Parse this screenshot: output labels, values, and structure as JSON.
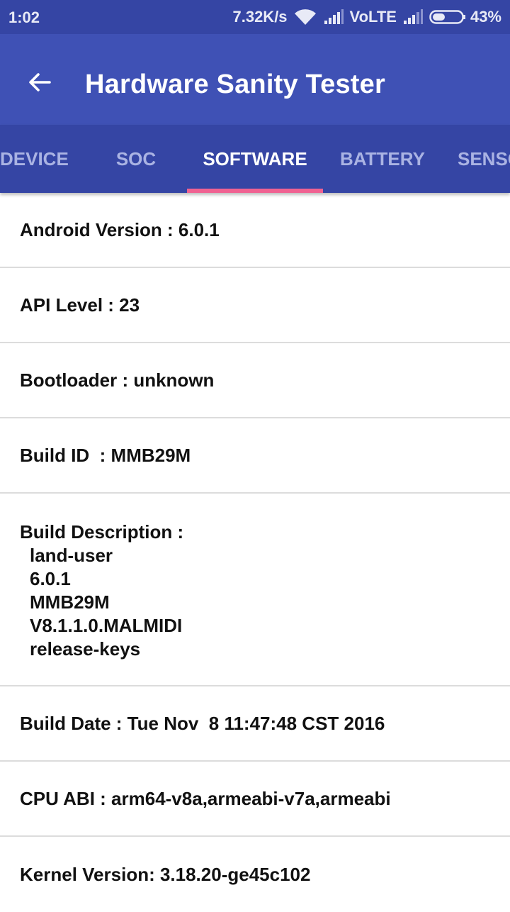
{
  "status_bar": {
    "time": "1:02",
    "net_speed": "7.32K/s",
    "volte": "VoLTE",
    "battery_percent": "43%",
    "battery_level": 0.43,
    "icons": [
      "wifi-icon",
      "signal-icon",
      "signal-icon",
      "battery-icon"
    ]
  },
  "app_bar": {
    "title": "Hardware Sanity Tester",
    "back_icon": "arrow-left-icon"
  },
  "tabs": [
    {
      "label": "DEVICE",
      "active": false
    },
    {
      "label": "SOC",
      "active": false
    },
    {
      "label": "SOFTWARE",
      "active": true
    },
    {
      "label": "BATTERY",
      "active": false
    },
    {
      "label": "SENSORS",
      "active": false
    }
  ],
  "info": {
    "android_version": "Android Version : 6.0.1",
    "api_level": "API Level : 23",
    "bootloader": "Bootloader : unknown",
    "build_id": "Build ID  : MMB29M",
    "build_description_label": "Build Description :",
    "build_description_lines": [
      "land-user",
      "6.0.1",
      "MMB29M",
      "V8.1.1.0.MALMIDI",
      "release-keys"
    ],
    "build_date": "Build Date : Tue Nov  8 11:47:48 CST 2016",
    "cpu_abi": "CPU ABI : arm64-v8a,armeabi-v7a,armeabi",
    "kernel_version": "Kernel Version: 3.18.20-ge45c102"
  },
  "colors": {
    "status_bar": "#3545a4",
    "app_bar": "#3f51b5",
    "tab_bar": "#3545a4",
    "tab_indicator": "#f06292",
    "tab_inactive_text": "#aab3e3"
  }
}
